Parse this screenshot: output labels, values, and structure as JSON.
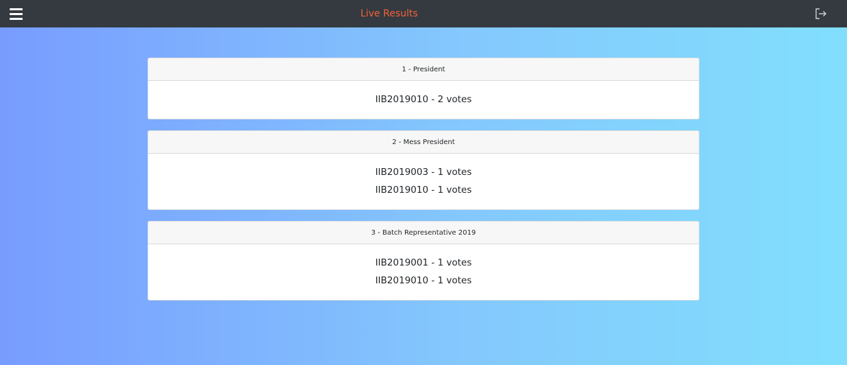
{
  "topbar": {
    "title": "Live Results",
    "menu_icon": "hamburger-menu-icon",
    "logout_icon": "logout-icon"
  },
  "colors": {
    "topbar_bg": "#343a40",
    "title": "#f4623a",
    "gradient_start": "#789cfe",
    "gradient_end": "#81dffd"
  },
  "cards": [
    {
      "header": "1 - President",
      "results": [
        "IIB2019010 - 2 votes"
      ]
    },
    {
      "header": "2 - Mess President",
      "results": [
        "IIB2019003 - 1 votes",
        "IIB2019010 - 1 votes"
      ]
    },
    {
      "header": "3 - Batch Representative 2019",
      "results": [
        "IIB2019001 - 1 votes",
        "IIB2019010 - 1 votes"
      ]
    }
  ]
}
